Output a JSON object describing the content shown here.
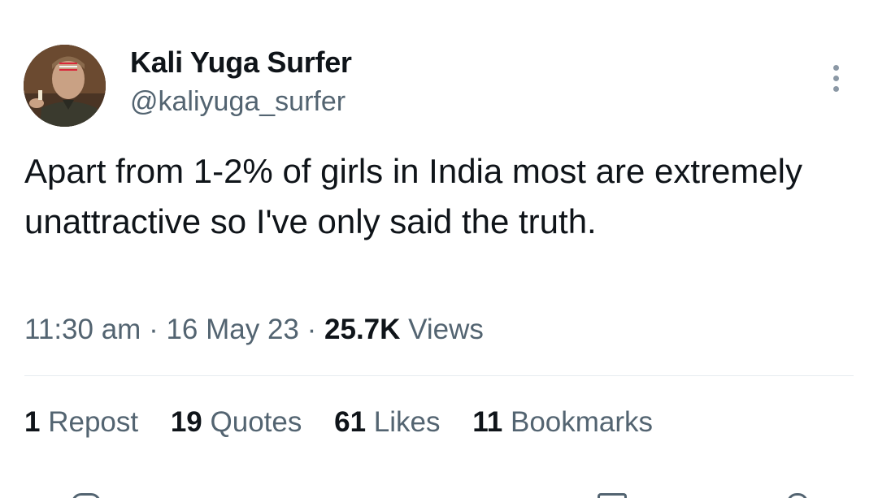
{
  "author": {
    "name": "Kali Yuga Surfer",
    "handle": "@kaliyuga_surfer"
  },
  "tweet": {
    "text": "Apart from 1-2% of girls in India most are extremely unattractive so I've only said the truth."
  },
  "meta": {
    "time": "11:30 am",
    "date": "16 May 23",
    "views_count": "25.7K",
    "views_label": "Views",
    "separator": "·"
  },
  "stats": {
    "reposts_count": "1",
    "reposts_label": "Repost",
    "quotes_count": "19",
    "quotes_label": "Quotes",
    "likes_count": "61",
    "likes_label": "Likes",
    "bookmarks_count": "11",
    "bookmarks_label": "Bookmarks"
  },
  "icons": {
    "more": "more-options-icon",
    "avatar": "profile-photo"
  },
  "colors": {
    "primary_text": "#0f1419",
    "secondary_text": "#536471",
    "divider": "#e6ecf0"
  }
}
